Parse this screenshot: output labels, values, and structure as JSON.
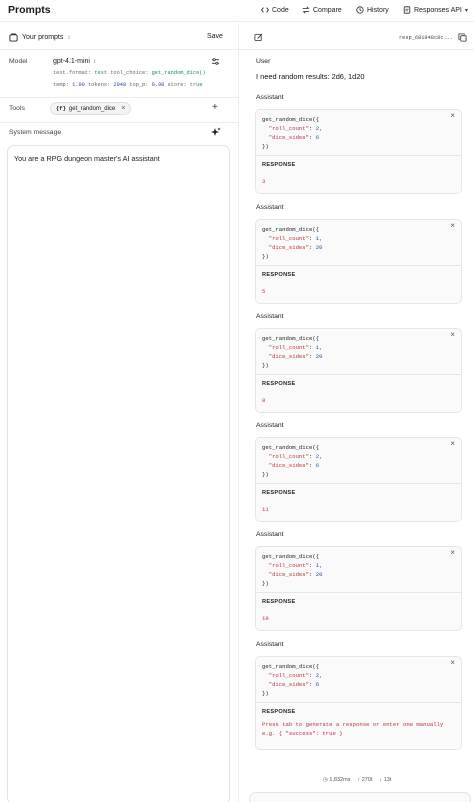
{
  "header": {
    "title": "Prompts",
    "nav": {
      "code": "Code",
      "compare": "Compare",
      "history": "History",
      "responses_api": "Responses API"
    }
  },
  "left": {
    "your_prompts": "Your prompts",
    "save": "Save",
    "model_label": "Model",
    "model_name": "gpt-4.1-mini",
    "model_params_line1": {
      "k1": "text.format:",
      "v1": "text",
      "k2": "tool_choice:",
      "v2": "get_random_dice()"
    },
    "model_params_line2": {
      "k1": "temp:",
      "v1": "1.00",
      "k2": "tokens:",
      "v2": "2048",
      "k3": "top_p:",
      "v3": "0.98",
      "k4": "store:",
      "v4": "true"
    },
    "tools_label": "Tools",
    "tool_chip": "get_random_dice",
    "system_label": "System message",
    "system_text": "You are a RPG dungeon master's AI assistant"
  },
  "right": {
    "response_id": "resp_681948c8c...",
    "user_label": "User",
    "user_text": "I need random results: 2d6, 1d20",
    "assistant_label": "Assistant",
    "response_label": "RESPONSE",
    "calls": [
      {
        "fn": "get_random_dice({",
        "roll_key": "\"roll_count\"",
        "roll_val": "2,",
        "sides_key": "\"dice_sides\"",
        "sides_val": "6",
        "end": "})",
        "result": "3"
      },
      {
        "fn": "get_random_dice({",
        "roll_key": "\"roll_count\"",
        "roll_val": "1,",
        "sides_key": "\"dice_sides\"",
        "sides_val": "20",
        "end": "})",
        "result": "5"
      },
      {
        "fn": "get_random_dice({",
        "roll_key": "\"roll_count\"",
        "roll_val": "1,",
        "sides_key": "\"dice_sides\"",
        "sides_val": "20",
        "end": "})",
        "result": "8"
      },
      {
        "fn": "get_random_dice({",
        "roll_key": "\"roll_count\"",
        "roll_val": "2,",
        "sides_key": "\"dice_sides\"",
        "sides_val": "6",
        "end": "})",
        "result": "11"
      },
      {
        "fn": "get_random_dice({",
        "roll_key": "\"roll_count\"",
        "roll_val": "1,",
        "sides_key": "\"dice_sides\"",
        "sides_val": "20",
        "end": "})",
        "result": "19"
      },
      {
        "fn": "get_random_dice({",
        "roll_key": "\"roll_count\"",
        "roll_val": "2,",
        "sides_key": "\"dice_sides\"",
        "sides_val": "6",
        "end": "})",
        "result": ""
      }
    ],
    "pending_note_1": "Press tab to generate a response or enter one manually",
    "pending_note_2": "e.g. { \"success\": true }",
    "stats": {
      "latency": "1,832ms",
      "tokens_in": "270t",
      "tokens_out": "13t"
    }
  },
  "colors": {
    "accent_red": "#c0303b",
    "accent_green": "#1a8a5a",
    "accent_blue": "#2a4aa0"
  }
}
